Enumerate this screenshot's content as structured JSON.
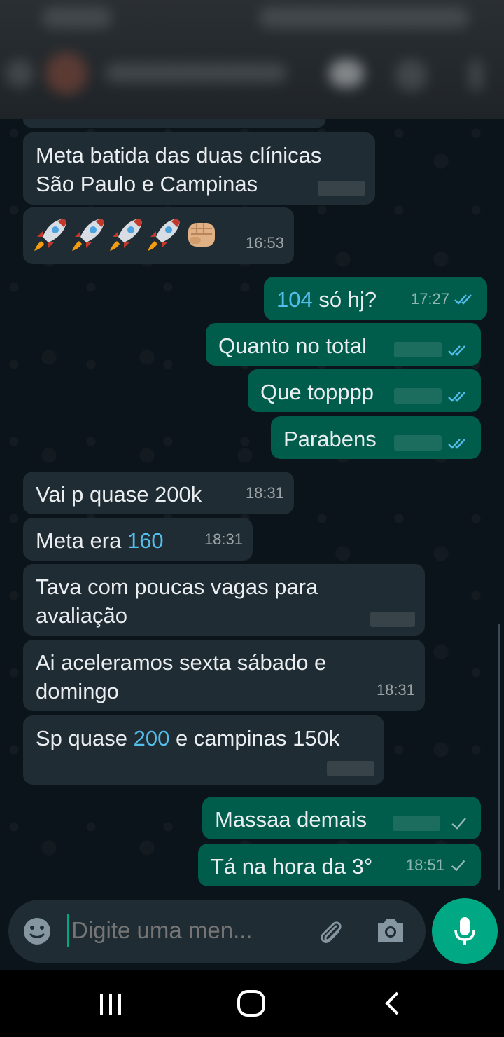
{
  "header": {
    "contact_name": "",
    "blurred": true
  },
  "messages": [
    {
      "id": "m1",
      "direction": "in",
      "text": "Meta batida das duas clínicas São Paulo e Campinas",
      "time": ""
    },
    {
      "id": "m2",
      "direction": "in",
      "emojis": [
        "rocket",
        "rocket",
        "rocket",
        "rocket",
        "fist"
      ],
      "time": "16:53"
    },
    {
      "id": "m3",
      "direction": "out",
      "text_link": "104",
      "text_rest": " só hj?",
      "time": "17:27",
      "status": "read"
    },
    {
      "id": "m4",
      "direction": "out",
      "text": "Quanto no total",
      "time": "",
      "status": "read"
    },
    {
      "id": "m5",
      "direction": "out",
      "text": "Que topppp",
      "time": "",
      "status": "read"
    },
    {
      "id": "m6",
      "direction": "out",
      "text": "Parabens",
      "time": "",
      "status": "read"
    },
    {
      "id": "m7",
      "direction": "in",
      "text": "Vai p quase 200k",
      "time": "18:31"
    },
    {
      "id": "m8",
      "direction": "in",
      "text_pre": "Meta era ",
      "text_link": "160",
      "time": "18:31"
    },
    {
      "id": "m9",
      "direction": "in",
      "line1": "Tava com poucas vagas para",
      "line2": "avaliação",
      "time": ""
    },
    {
      "id": "m10",
      "direction": "in",
      "line1": "Ai aceleramos sexta sábado e",
      "line2": "domingo",
      "time": "18:31"
    },
    {
      "id": "m11",
      "direction": "in",
      "text_pre": "Sp quase ",
      "text_link": "200",
      "text_rest": " e campinas 150k",
      "time": ""
    },
    {
      "id": "m12",
      "direction": "out",
      "text": "Massaa demais",
      "time": "",
      "status": "sent"
    },
    {
      "id": "m13",
      "direction": "out",
      "text": "Tá na hora da 3°",
      "time": "18:51",
      "status": "sent"
    }
  ],
  "composer": {
    "placeholder": "Digite uma men...",
    "icons": [
      "emoji-icon",
      "attach-icon",
      "camera-icon",
      "mic-icon"
    ]
  },
  "colors": {
    "background": "#0b141a",
    "incoming_bubble": "#202c33",
    "outgoing_bubble": "#005c4b",
    "link": "#53bdeb",
    "accent": "#00a884",
    "read_ticks": "#53bdeb"
  }
}
